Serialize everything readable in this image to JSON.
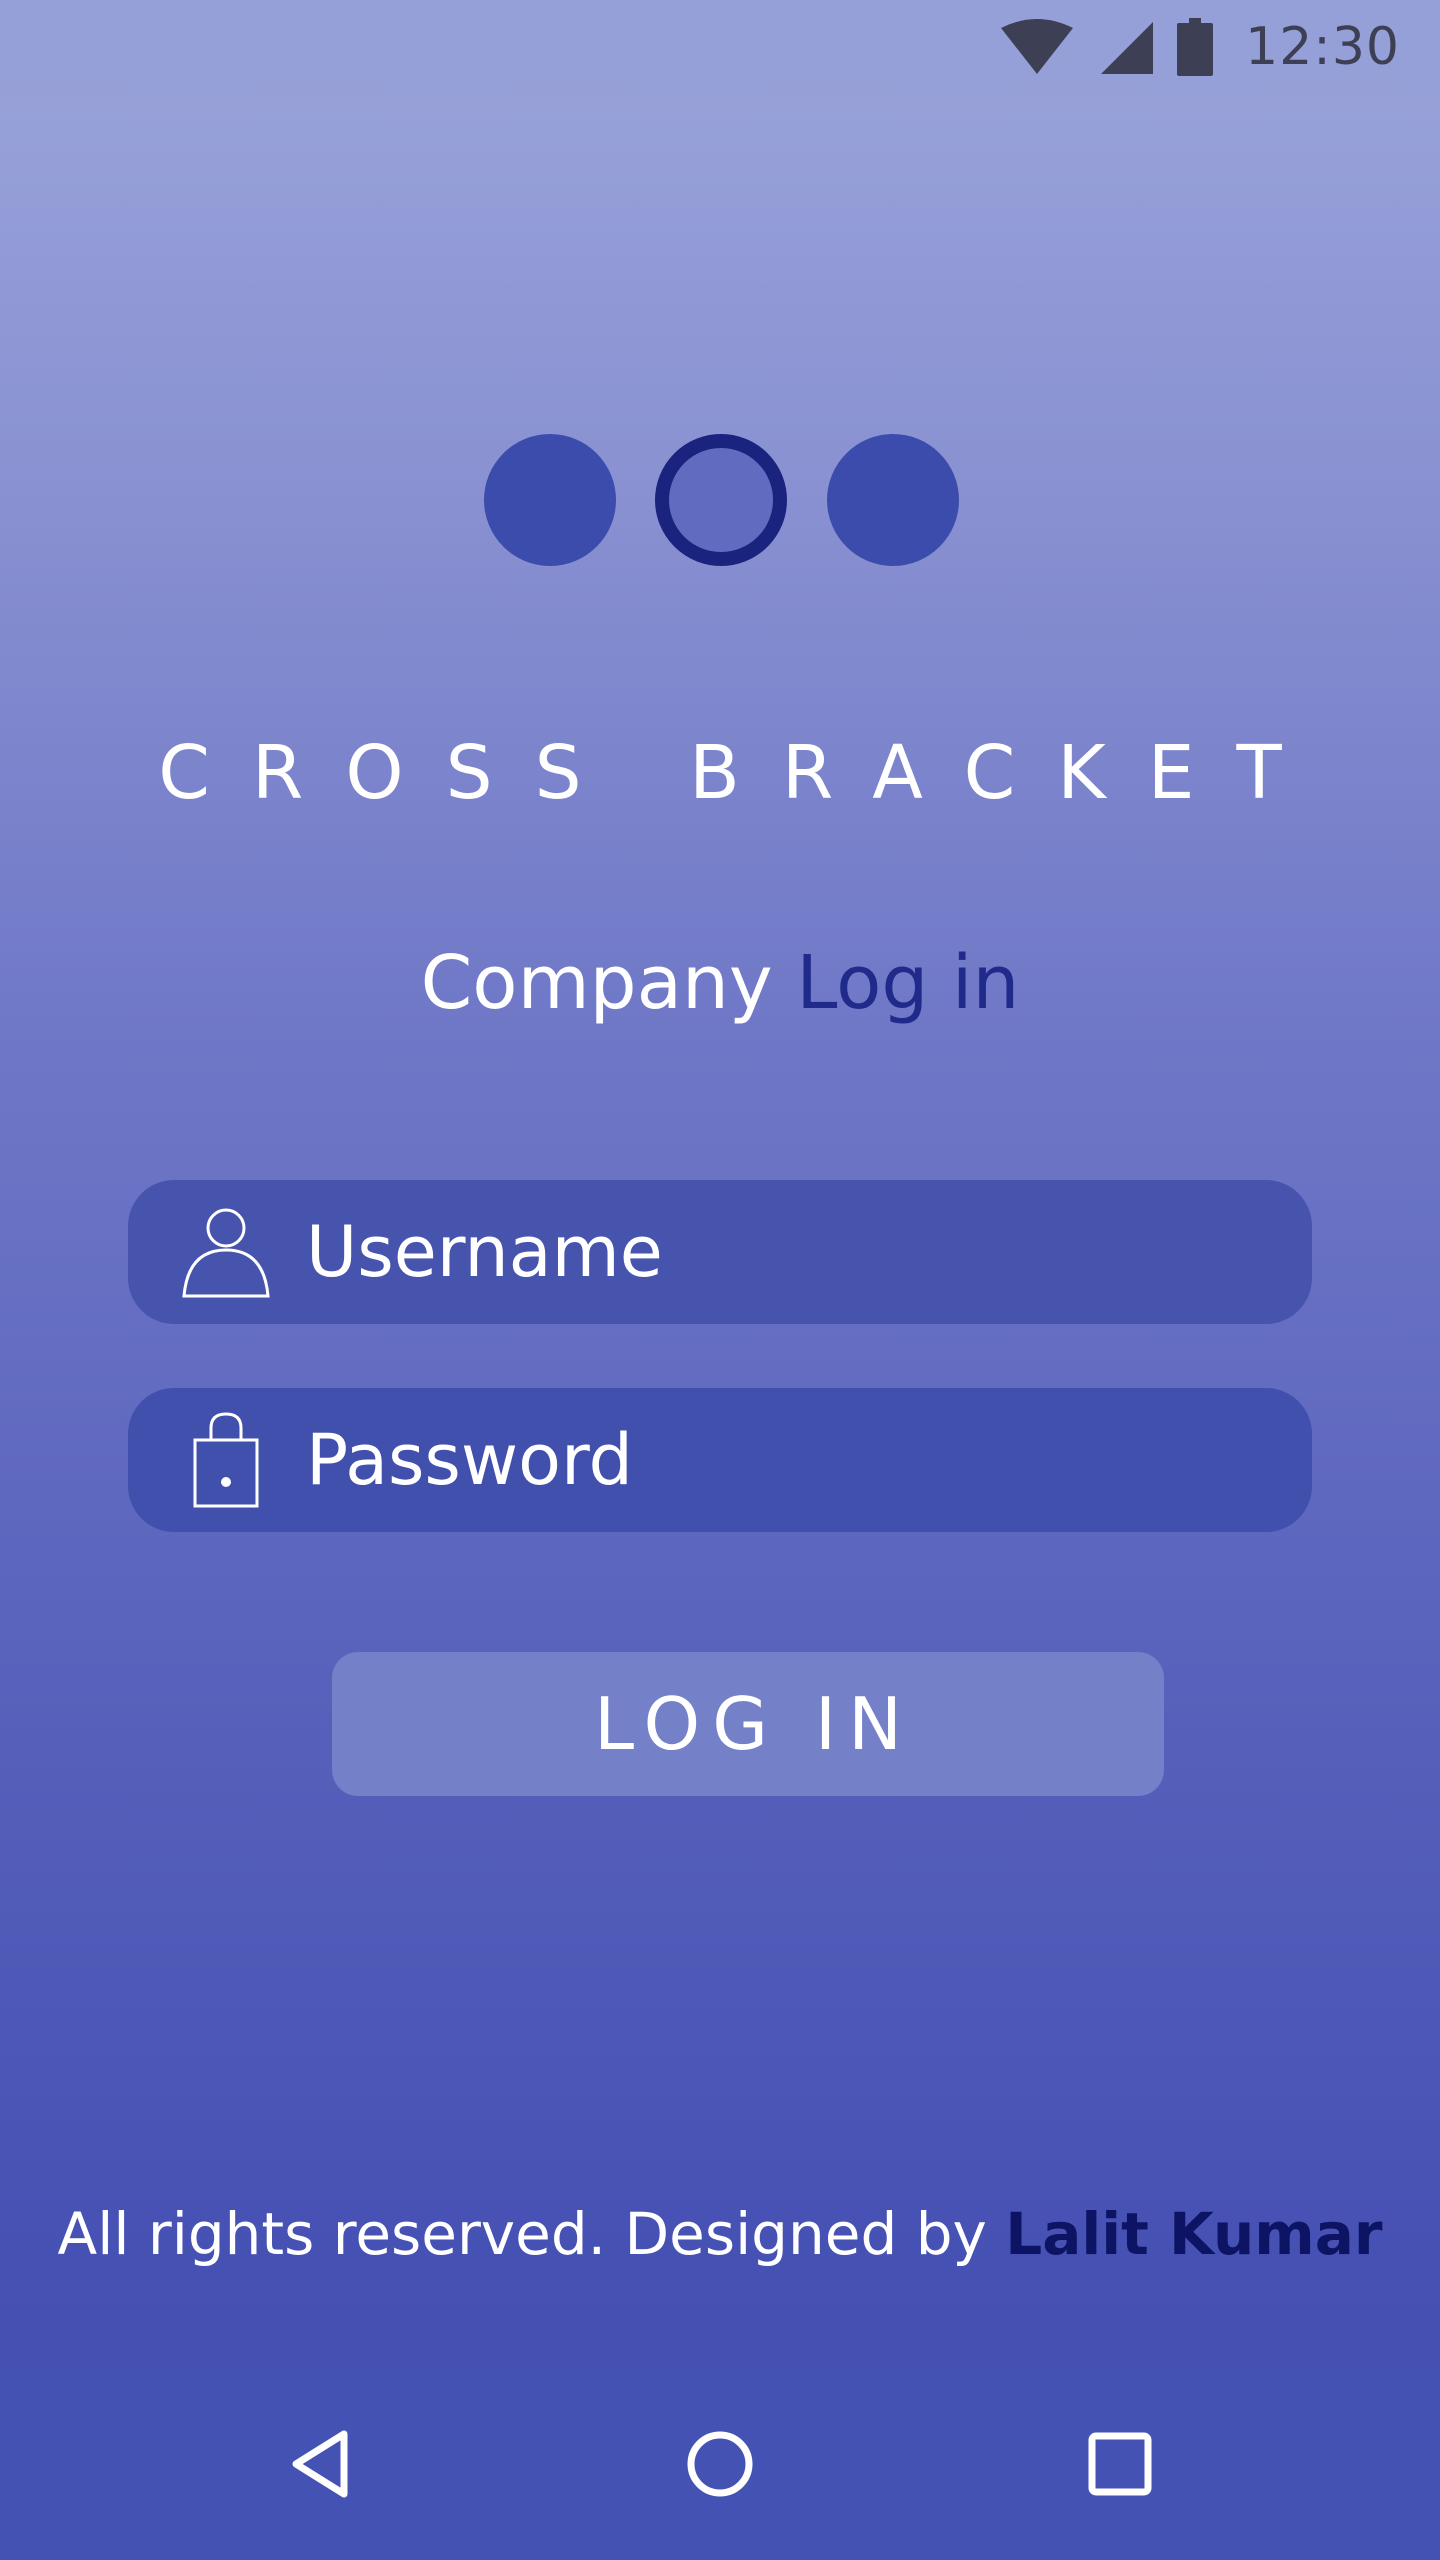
{
  "status_bar": {
    "time": "12:30",
    "icons": [
      "wifi-icon",
      "cellular-signal-icon",
      "battery-icon"
    ]
  },
  "brand": {
    "logo_icons": [
      "dot-icon",
      "ring-dot-icon",
      "dot-icon"
    ],
    "name": "CROSS BRACKET"
  },
  "subtitle": {
    "prefix": "Company",
    "accent": "Log in"
  },
  "form": {
    "username": {
      "icon": "person-icon",
      "placeholder": "Username",
      "value": ""
    },
    "password": {
      "icon": "lock-icon",
      "placeholder": "Password",
      "value": ""
    },
    "login_label": "LOG IN"
  },
  "footer": {
    "text": "All rights reserved. Designed by",
    "author": "Lalit Kumar"
  },
  "nav_bar": {
    "icons": [
      "back-icon",
      "home-icon",
      "recent-apps-icon"
    ]
  },
  "colors": {
    "accent": "#1f2a8a",
    "author": "#0d1463",
    "field_bg": "#4452ae",
    "button_bg": "#7480c8",
    "logo_dot": "#3b4cac"
  }
}
